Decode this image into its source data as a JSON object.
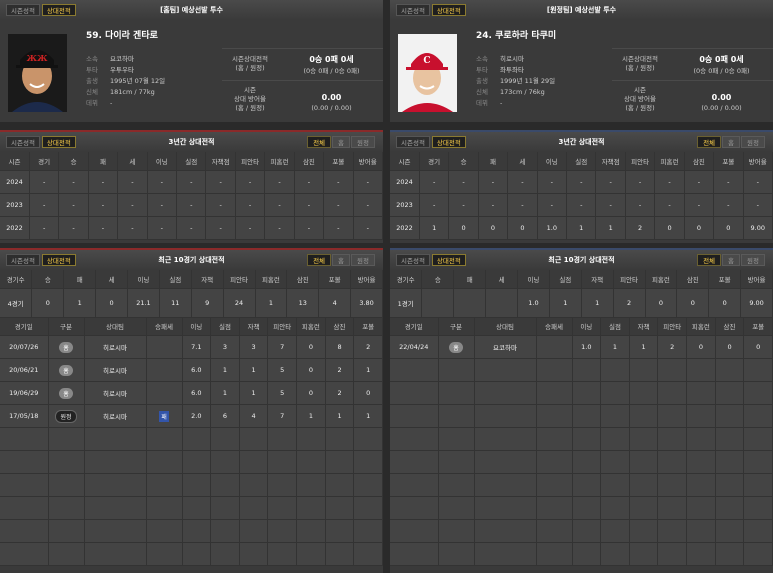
{
  "left": {
    "header": {
      "tabs": [
        "시즌성적",
        "상대전적"
      ],
      "active": 1,
      "title": "[홈팀] 예상선발 투수"
    },
    "pitcher": {
      "name": "59. 다이라 겐타로",
      "info": [
        {
          "k": "소속",
          "v": "요코하마"
        },
        {
          "k": "투타",
          "v": "우투우타"
        },
        {
          "k": "출생",
          "v": "1995년 07월 12일"
        },
        {
          "k": "신체",
          "v": "181cm / 77kg"
        },
        {
          "k": "데뷔",
          "v": "-"
        }
      ],
      "season_label": "시즌상대전적",
      "season_sub": "(홈 / 원정)",
      "season_val": "0승 0패 0세",
      "season_val2": "(0승 0패 / 0승 0패)",
      "era_label": "시즌",
      "era_label2": "상대 방어율",
      "era_sub": "(홈 / 원정)",
      "era_val": "0.00",
      "era_val2": "(0.00 / 0.00)"
    },
    "three": {
      "tabs": [
        "시즌성적",
        "상대전적"
      ],
      "title": "3년간 상대전적",
      "buttons": [
        "전체",
        "홈",
        "원정"
      ],
      "headers": [
        "시즌",
        "경기",
        "승",
        "패",
        "세",
        "이닝",
        "실점",
        "자책점",
        "피안타",
        "피홈런",
        "삼진",
        "포볼",
        "방어율"
      ],
      "rows": [
        [
          "2024",
          "-",
          "-",
          "-",
          "-",
          "-",
          "-",
          "-",
          "-",
          "-",
          "-",
          "-",
          "-"
        ],
        [
          "2023",
          "-",
          "-",
          "-",
          "-",
          "-",
          "-",
          "-",
          "-",
          "-",
          "-",
          "-",
          "-"
        ],
        [
          "2022",
          "-",
          "-",
          "-",
          "-",
          "-",
          "-",
          "-",
          "-",
          "-",
          "-",
          "-",
          "-"
        ]
      ]
    },
    "recent": {
      "tabs": [
        "시즌성적",
        "상대전적"
      ],
      "title": "최근 10경기 상대전적",
      "buttons": [
        "전체",
        "홈",
        "원정"
      ],
      "sum_headers": [
        "경기수",
        "승",
        "패",
        "세",
        "이닝",
        "실점",
        "자책",
        "피안타",
        "피홈런",
        "삼진",
        "포볼",
        "방어율"
      ],
      "sum_row": [
        "4경기",
        "0",
        "1",
        "0",
        "21.1",
        "11",
        "9",
        "24",
        "1",
        "13",
        "4",
        "3.80"
      ],
      "game_headers": [
        "경기일",
        "구분",
        "상대팀",
        "승패세",
        "이닝",
        "실점",
        "자책",
        "피안타",
        "피홈런",
        "삼진",
        "포볼"
      ],
      "games": [
        [
          "20/07/26",
          "홈",
          "히로시마",
          "",
          "7.1",
          "3",
          "3",
          "7",
          "0",
          "8",
          "2"
        ],
        [
          "20/06/21",
          "홈",
          "히로시마",
          "",
          "6.0",
          "1",
          "1",
          "5",
          "0",
          "2",
          "1"
        ],
        [
          "19/06/29",
          "홈",
          "히로시마",
          "",
          "6.0",
          "1",
          "1",
          "5",
          "0",
          "2",
          "0"
        ],
        [
          "17/05/18",
          "원정",
          "히로시마",
          "패",
          "2.0",
          "6",
          "4",
          "7",
          "1",
          "1",
          "1"
        ]
      ]
    }
  },
  "right": {
    "header": {
      "tabs": [
        "시즌성적",
        "상대전적"
      ],
      "active": 1,
      "title": "[원정팀] 예상선발 투수"
    },
    "pitcher": {
      "name": "24. 쿠로하라 타쿠미",
      "info": [
        {
          "k": "소속",
          "v": "히로시마"
        },
        {
          "k": "투타",
          "v": "좌투좌타"
        },
        {
          "k": "출생",
          "v": "1999년 11월 29일"
        },
        {
          "k": "신체",
          "v": "173cm / 76kg"
        },
        {
          "k": "데뷔",
          "v": "-"
        }
      ],
      "season_label": "시즌상대전적",
      "season_sub": "(홈 / 원정)",
      "season_val": "0승 0패 0세",
      "season_val2": "(0승 0패 / 0승 0패)",
      "era_label": "시즌",
      "era_label2": "상대 방어율",
      "era_sub": "(홈 / 원정)",
      "era_val": "0.00",
      "era_val2": "(0.00 / 0.00)"
    },
    "three": {
      "tabs": [
        "시즌성적",
        "상대전적"
      ],
      "title": "3년간 상대전적",
      "buttons": [
        "전체",
        "홈",
        "원정"
      ],
      "headers": [
        "시즌",
        "경기",
        "승",
        "패",
        "세",
        "이닝",
        "실점",
        "자책점",
        "피안타",
        "피홈런",
        "삼진",
        "포볼",
        "방어율"
      ],
      "rows": [
        [
          "2024",
          "-",
          "-",
          "-",
          "-",
          "-",
          "-",
          "-",
          "-",
          "-",
          "-",
          "-",
          "-"
        ],
        [
          "2023",
          "-",
          "-",
          "-",
          "-",
          "-",
          "-",
          "-",
          "-",
          "-",
          "-",
          "-",
          "-"
        ],
        [
          "2022",
          "1",
          "0",
          "0",
          "0",
          "1.0",
          "1",
          "1",
          "2",
          "0",
          "0",
          "0",
          "9.00"
        ]
      ]
    },
    "recent": {
      "tabs": [
        "시즌성적",
        "상대전적"
      ],
      "title": "최근 10경기 상대전적",
      "buttons": [
        "전체",
        "홈",
        "원정"
      ],
      "sum_headers": [
        "경기수",
        "승",
        "패",
        "세",
        "이닝",
        "실점",
        "자책",
        "피안타",
        "피홈런",
        "삼진",
        "포볼",
        "방어율"
      ],
      "sum_row": [
        "1경기",
        "",
        "",
        "",
        "1.0",
        "1",
        "1",
        "2",
        "0",
        "0",
        "0",
        "9.00"
      ],
      "game_headers": [
        "경기일",
        "구분",
        "상대팀",
        "승패세",
        "이닝",
        "실점",
        "자책",
        "피안타",
        "피홈런",
        "삼진",
        "포볼"
      ],
      "games": [
        [
          "22/04/24",
          "홈",
          "요코하마",
          "",
          "1.0",
          "1",
          "1",
          "2",
          "0",
          "0",
          "0"
        ]
      ]
    }
  }
}
